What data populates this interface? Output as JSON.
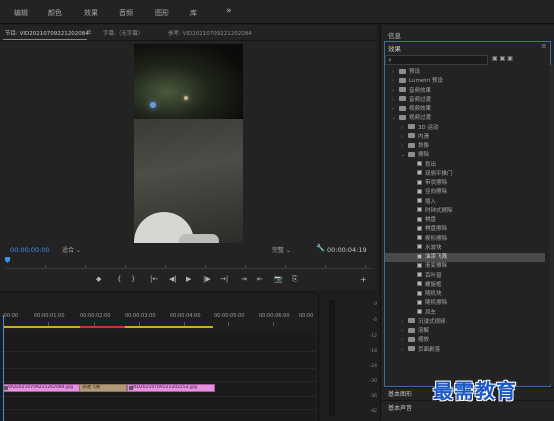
{
  "workspace_tabs": [
    "编辑",
    "颜色",
    "效果",
    "音频",
    "图形",
    "库"
  ],
  "workspace_more": "»",
  "program": {
    "tab_program": "节目: VID20210709221202084",
    "tab_menu": "≡",
    "tab_caption": "字幕:（无字幕）",
    "tab_source": "参考: VID20210709221202084",
    "timecode_current": "00:00:00:00",
    "fit_select": "适合",
    "quality_select": "完整",
    "timecode_duration": "00:00:04:19",
    "transport_icons": [
      "◆",
      "{",
      "}",
      "|←",
      "◀|",
      "▶",
      "|▶",
      "→|",
      "⇥",
      "⇤",
      "📷",
      "⎘"
    ],
    "add_button": "+"
  },
  "timeline": {
    "ruler_labels": [
      ":00:00",
      "00:00:01:00",
      "00:00:02:00",
      "00:00:03:00",
      "00:00:04:00",
      "00:00:05:00",
      "00:00:06:00",
      "00:00"
    ],
    "clip1_label": "VID20210709221202084.jpg",
    "transition_label": "渗透飞溅",
    "clip2_label": "VID20210709221202253.jpg"
  },
  "meter": {
    "labels": [
      "0",
      "-6",
      "-12",
      "-18",
      "-24",
      "-30",
      "-36",
      "-42"
    ]
  },
  "right_panel": {
    "info_title": "信息",
    "effects_title": "效果",
    "effects_menu": "≡",
    "search_icon": "⌕",
    "filter_icons": [
      "▣",
      "▣",
      "▣"
    ],
    "tree": [
      {
        "level": 0,
        "type": "folder",
        "caret": "›",
        "label": "预设"
      },
      {
        "level": 0,
        "type": "folder",
        "caret": "›",
        "label": "Lumetri 预设"
      },
      {
        "level": 0,
        "type": "folder",
        "caret": "›",
        "label": "音频效果"
      },
      {
        "level": 0,
        "type": "folder",
        "caret": "›",
        "label": "音频过渡"
      },
      {
        "level": 0,
        "type": "folder",
        "caret": "›",
        "label": "视频效果"
      },
      {
        "level": 0,
        "type": "folder",
        "caret": "⌄",
        "label": "视频过渡"
      },
      {
        "level": 1,
        "type": "folder",
        "caret": "›",
        "label": "3D 运动"
      },
      {
        "level": 1,
        "type": "folder",
        "caret": "›",
        "label": "内滑"
      },
      {
        "level": 1,
        "type": "folder",
        "caret": "›",
        "label": "划像"
      },
      {
        "level": 1,
        "type": "folder",
        "caret": "⌄",
        "label": "擦除"
      },
      {
        "level": 2,
        "type": "effect",
        "caret": "",
        "label": "划出"
      },
      {
        "level": 2,
        "type": "effect",
        "caret": "",
        "label": "双侧平推门"
      },
      {
        "level": 2,
        "type": "effect",
        "caret": "",
        "label": "带状擦除"
      },
      {
        "level": 2,
        "type": "effect",
        "caret": "",
        "label": "径向擦除"
      },
      {
        "level": 2,
        "type": "effect",
        "caret": "",
        "label": "插入"
      },
      {
        "level": 2,
        "type": "effect",
        "caret": "",
        "label": "时钟式擦除"
      },
      {
        "level": 2,
        "type": "effect",
        "caret": "",
        "label": "棋盘"
      },
      {
        "level": 2,
        "type": "effect",
        "caret": "",
        "label": "棋盘擦除"
      },
      {
        "level": 2,
        "type": "effect",
        "caret": "",
        "label": "楔形擦除"
      },
      {
        "level": 2,
        "type": "effect",
        "caret": "",
        "label": "水波块"
      },
      {
        "level": 2,
        "type": "effect",
        "caret": "",
        "label": "油漆飞溅",
        "selected": true
      },
      {
        "level": 2,
        "type": "effect",
        "caret": "",
        "label": "渐变擦除"
      },
      {
        "level": 2,
        "type": "effect",
        "caret": "",
        "label": "百叶窗"
      },
      {
        "level": 2,
        "type": "effect",
        "caret": "",
        "label": "螺旋框"
      },
      {
        "level": 2,
        "type": "effect",
        "caret": "",
        "label": "随机块"
      },
      {
        "level": 2,
        "type": "effect",
        "caret": "",
        "label": "随机擦除"
      },
      {
        "level": 2,
        "type": "effect",
        "caret": "",
        "label": "风车"
      },
      {
        "level": 1,
        "type": "folder",
        "caret": "›",
        "label": "沉浸式视频"
      },
      {
        "level": 1,
        "type": "folder",
        "caret": "›",
        "label": "溶解"
      },
      {
        "level": 1,
        "type": "folder",
        "caret": "›",
        "label": "缩放"
      },
      {
        "level": 1,
        "type": "folder",
        "caret": "›",
        "label": "页面剥落"
      }
    ],
    "basic_graphics": "基本图形",
    "basic_sound": "基本声音"
  },
  "watermark": "最需教育"
}
